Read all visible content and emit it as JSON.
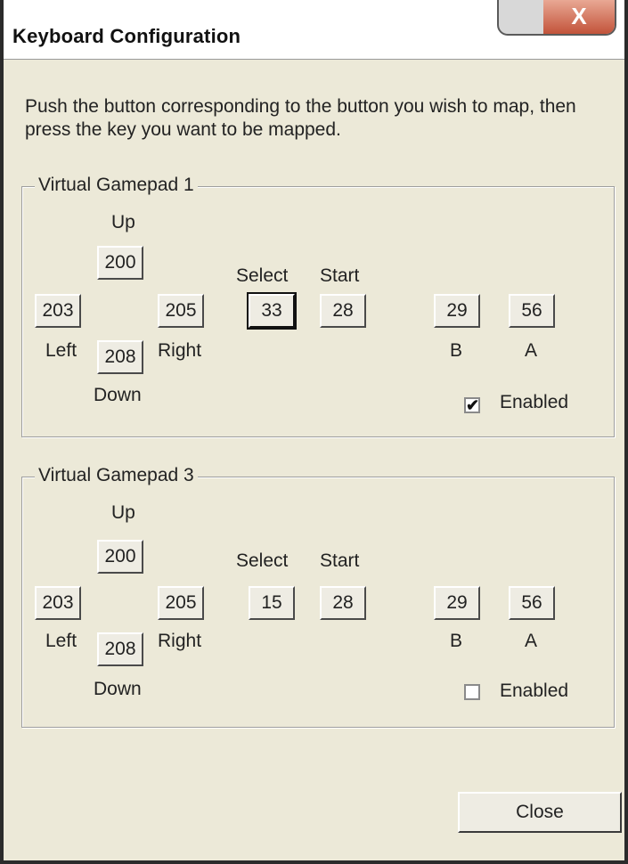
{
  "window": {
    "title": "Keyboard Configuration",
    "close_glyph": "X"
  },
  "instructions": "Push the button corresponding to the button you wish to map, then press the key you want to be mapped.",
  "gamepads": [
    {
      "legend": "Virtual Gamepad 1",
      "up_label": "Up",
      "up_value": "200",
      "left_label": "Left",
      "left_value": "203",
      "right_label": "Right",
      "right_value": "205",
      "down_label": "Down",
      "down_value": "208",
      "select_label": "Select",
      "select_value": "33",
      "start_label": "Start",
      "start_value": "28",
      "b_label": "B",
      "b_value": "29",
      "a_label": "A",
      "a_value": "56",
      "enabled_label": "Enabled",
      "enabled": true
    },
    {
      "legend": "Virtual Gamepad 3",
      "up_label": "Up",
      "up_value": "200",
      "left_label": "Left",
      "left_value": "203",
      "right_label": "Right",
      "right_value": "205",
      "down_label": "Down",
      "down_value": "208",
      "select_label": "Select",
      "select_value": "15",
      "start_label": "Start",
      "start_value": "28",
      "b_label": "B",
      "b_value": "29",
      "a_label": "A",
      "a_value": "56",
      "enabled_label": "Enabled",
      "enabled": false
    }
  ],
  "focused_button": "Select (Virtual Gamepad 1)",
  "close_button_label": "Close",
  "colors": {
    "dialog_bg": "#ece9d8",
    "title_close_red": "#c2533a"
  },
  "icons": {
    "check": "check-icon",
    "close": "close-icon"
  }
}
